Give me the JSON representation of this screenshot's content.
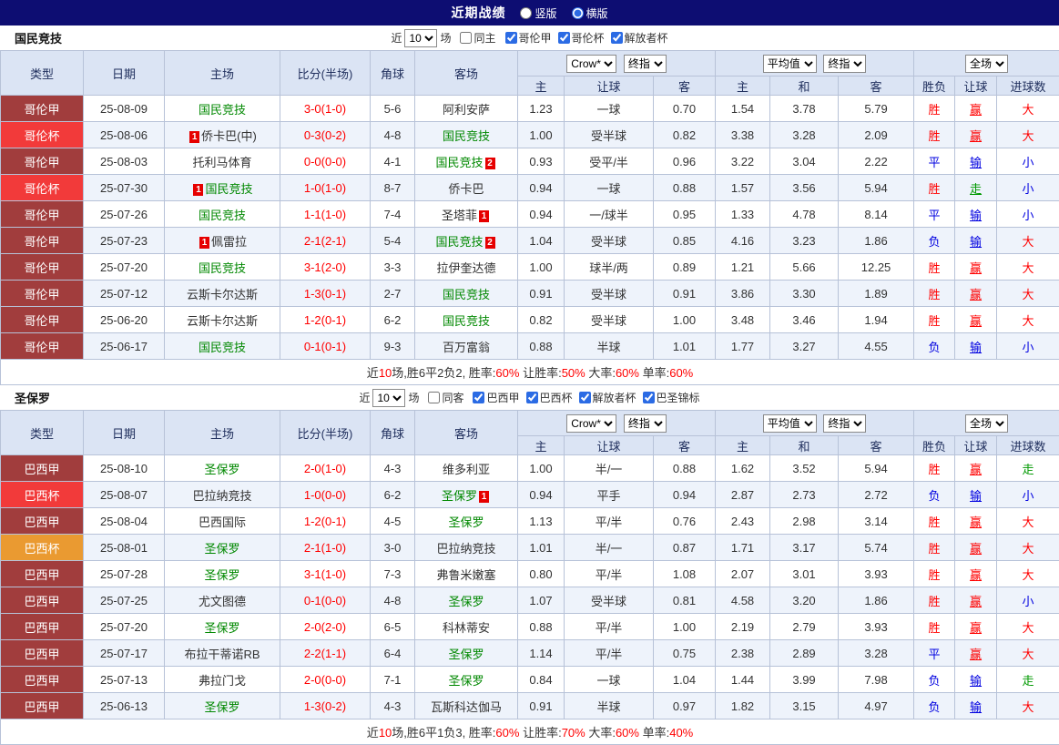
{
  "topbar": {
    "title": "近期战绩",
    "options": [
      {
        "label": "竖版",
        "selected": false
      },
      {
        "label": "横版",
        "selected": true
      }
    ]
  },
  "labels": {
    "recent": "近",
    "matches": "场"
  },
  "table_header": {
    "type": "类型",
    "date": "日期",
    "home": "主场",
    "score": "比分(半场)",
    "corners": "角球",
    "away": "客场",
    "sub": [
      "主",
      "让球",
      "客",
      "主",
      "和",
      "客",
      "胜负",
      "让球",
      "进球数"
    ],
    "selects": {
      "company": "Crow*",
      "final1": "终指",
      "avg": "平均值",
      "final2": "终指",
      "scope": "全场"
    }
  },
  "sections": [
    {
      "team": "国民竞技",
      "filters": {
        "count": "10",
        "same": {
          "label": "同主",
          "checked": false
        },
        "leagues": [
          {
            "label": "哥伦甲",
            "checked": true
          },
          {
            "label": "哥伦杯",
            "checked": true
          },
          {
            "label": "解放者杯",
            "checked": true
          }
        ]
      },
      "rows": [
        {
          "league": "哥伦甲",
          "lg": "a",
          "date": "25-08-09",
          "home": {
            "name": "国民竞技",
            "self": true
          },
          "score": "3-0(1-0)",
          "corners": "5-6",
          "away": {
            "name": "阿利安萨",
            "self": false
          },
          "handicap": [
            "1.23",
            "一球",
            "0.70"
          ],
          "europe": [
            "1.54",
            "3.78",
            "5.79"
          ],
          "results": [
            {
              "t": "胜",
              "c": "r"
            },
            {
              "t": "赢",
              "c": "r"
            },
            {
              "t": "大",
              "c": "r"
            }
          ]
        },
        {
          "league": "哥伦杯",
          "lg": "cup",
          "date": "25-08-06",
          "home": {
            "name": "侨卡巴(中)",
            "self": false,
            "badge": "1",
            "pos": "before"
          },
          "score": "0-3(0-2)",
          "corners": "4-8",
          "away": {
            "name": "国民竞技",
            "self": true
          },
          "handicap": [
            "1.00",
            "受半球",
            "0.82"
          ],
          "europe": [
            "3.38",
            "3.28",
            "2.09"
          ],
          "results": [
            {
              "t": "胜",
              "c": "r"
            },
            {
              "t": "赢",
              "c": "r"
            },
            {
              "t": "大",
              "c": "r"
            }
          ]
        },
        {
          "league": "哥伦甲",
          "lg": "a",
          "date": "25-08-03",
          "home": {
            "name": "托利马体育",
            "self": false
          },
          "score": "0-0(0-0)",
          "corners": "4-1",
          "away": {
            "name": "国民竞技",
            "self": true,
            "badge": "2",
            "pos": "after"
          },
          "handicap": [
            "0.93",
            "受平/半",
            "0.96"
          ],
          "europe": [
            "3.22",
            "3.04",
            "2.22"
          ],
          "results": [
            {
              "t": "平",
              "c": "b"
            },
            {
              "t": "输",
              "c": "b"
            },
            {
              "t": "小",
              "c": "b"
            }
          ]
        },
        {
          "league": "哥伦杯",
          "lg": "cup",
          "date": "25-07-30",
          "home": {
            "name": "国民竞技",
            "self": true,
            "badge": "1",
            "pos": "before"
          },
          "score": "1-0(1-0)",
          "corners": "8-7",
          "away": {
            "name": "侨卡巴",
            "self": false
          },
          "handicap": [
            "0.94",
            "一球",
            "0.88"
          ],
          "europe": [
            "1.57",
            "3.56",
            "5.94"
          ],
          "results": [
            {
              "t": "胜",
              "c": "r"
            },
            {
              "t": "走",
              "c": "g"
            },
            {
              "t": "小",
              "c": "b"
            }
          ]
        },
        {
          "league": "哥伦甲",
          "lg": "a",
          "date": "25-07-26",
          "home": {
            "name": "国民竞技",
            "self": true
          },
          "score": "1-1(1-0)",
          "corners": "7-4",
          "away": {
            "name": "圣塔菲",
            "self": false,
            "badge": "1",
            "pos": "after"
          },
          "handicap": [
            "0.94",
            "一/球半",
            "0.95"
          ],
          "europe": [
            "1.33",
            "4.78",
            "8.14"
          ],
          "results": [
            {
              "t": "平",
              "c": "b"
            },
            {
              "t": "输",
              "c": "b"
            },
            {
              "t": "小",
              "c": "b"
            }
          ]
        },
        {
          "league": "哥伦甲",
          "lg": "a",
          "date": "25-07-23",
          "home": {
            "name": "佩雷拉",
            "self": false,
            "badge": "1",
            "pos": "before"
          },
          "score": "2-1(2-1)",
          "corners": "5-4",
          "away": {
            "name": "国民竞技",
            "self": true,
            "badge": "2",
            "pos": "after"
          },
          "handicap": [
            "1.04",
            "受半球",
            "0.85"
          ],
          "europe": [
            "4.16",
            "3.23",
            "1.86"
          ],
          "results": [
            {
              "t": "负",
              "c": "b"
            },
            {
              "t": "输",
              "c": "b"
            },
            {
              "t": "大",
              "c": "r"
            }
          ]
        },
        {
          "league": "哥伦甲",
          "lg": "a",
          "date": "25-07-20",
          "home": {
            "name": "国民竞技",
            "self": true
          },
          "score": "3-1(2-0)",
          "corners": "3-3",
          "away": {
            "name": "拉伊奎达德",
            "self": false
          },
          "handicap": [
            "1.00",
            "球半/两",
            "0.89"
          ],
          "europe": [
            "1.21",
            "5.66",
            "12.25"
          ],
          "results": [
            {
              "t": "胜",
              "c": "r"
            },
            {
              "t": "赢",
              "c": "r"
            },
            {
              "t": "大",
              "c": "r"
            }
          ]
        },
        {
          "league": "哥伦甲",
          "lg": "a",
          "date": "25-07-12",
          "home": {
            "name": "云斯卡尔达斯",
            "self": false
          },
          "score": "1-3(0-1)",
          "corners": "2-7",
          "away": {
            "name": "国民竞技",
            "self": true
          },
          "handicap": [
            "0.91",
            "受半球",
            "0.91"
          ],
          "europe": [
            "3.86",
            "3.30",
            "1.89"
          ],
          "results": [
            {
              "t": "胜",
              "c": "r"
            },
            {
              "t": "赢",
              "c": "r"
            },
            {
              "t": "大",
              "c": "r"
            }
          ]
        },
        {
          "league": "哥伦甲",
          "lg": "a",
          "date": "25-06-20",
          "home": {
            "name": "云斯卡尔达斯",
            "self": false
          },
          "score": "1-2(0-1)",
          "corners": "6-2",
          "away": {
            "name": "国民竞技",
            "self": true
          },
          "handicap": [
            "0.82",
            "受半球",
            "1.00"
          ],
          "europe": [
            "3.48",
            "3.46",
            "1.94"
          ],
          "results": [
            {
              "t": "胜",
              "c": "r"
            },
            {
              "t": "赢",
              "c": "r"
            },
            {
              "t": "大",
              "c": "r"
            }
          ]
        },
        {
          "league": "哥伦甲",
          "lg": "a",
          "date": "25-06-17",
          "home": {
            "name": "国民竞技",
            "self": true
          },
          "score": "0-1(0-1)",
          "corners": "9-3",
          "away": {
            "name": "百万富翁",
            "self": false
          },
          "handicap": [
            "0.88",
            "半球",
            "1.01"
          ],
          "europe": [
            "1.77",
            "3.27",
            "4.55"
          ],
          "results": [
            {
              "t": "负",
              "c": "b"
            },
            {
              "t": "输",
              "c": "b"
            },
            {
              "t": "小",
              "c": "b"
            }
          ]
        }
      ],
      "summary": [
        {
          "t": "近"
        },
        {
          "t": "10",
          "red": true
        },
        {
          "t": "场,胜6平2负2, 胜率:"
        },
        {
          "t": "60%",
          "red": true
        },
        {
          "t": " 让胜率:"
        },
        {
          "t": "50%",
          "red": true
        },
        {
          "t": " 大率:"
        },
        {
          "t": "60%",
          "red": true
        },
        {
          "t": " 单率:"
        },
        {
          "t": "60%",
          "red": true
        }
      ]
    },
    {
      "team": "圣保罗",
      "filters": {
        "count": "10",
        "same": {
          "label": "同客",
          "checked": false
        },
        "leagues": [
          {
            "label": "巴西甲",
            "checked": true
          },
          {
            "label": "巴西杯",
            "checked": true
          },
          {
            "label": "解放者杯",
            "checked": true
          },
          {
            "label": "巴圣锦标",
            "checked": true
          }
        ]
      },
      "rows": [
        {
          "league": "巴西甲",
          "lg": "a",
          "date": "25-08-10",
          "home": {
            "name": "圣保罗",
            "self": true
          },
          "score": "2-0(1-0)",
          "corners": "4-3",
          "away": {
            "name": "维多利亚",
            "self": false
          },
          "handicap": [
            "1.00",
            "半/一",
            "0.88"
          ],
          "europe": [
            "1.62",
            "3.52",
            "5.94"
          ],
          "results": [
            {
              "t": "胜",
              "c": "r"
            },
            {
              "t": "赢",
              "c": "r"
            },
            {
              "t": "走",
              "c": "g"
            }
          ]
        },
        {
          "league": "巴西杯",
          "lg": "cup",
          "date": "25-08-07",
          "home": {
            "name": "巴拉纳竞技",
            "self": false
          },
          "score": "1-0(0-0)",
          "corners": "6-2",
          "away": {
            "name": "圣保罗",
            "self": true,
            "badge": "1",
            "pos": "after"
          },
          "handicap": [
            "0.94",
            "平手",
            "0.94"
          ],
          "europe": [
            "2.87",
            "2.73",
            "2.72"
          ],
          "results": [
            {
              "t": "负",
              "c": "b"
            },
            {
              "t": "输",
              "c": "b"
            },
            {
              "t": "小",
              "c": "b"
            }
          ]
        },
        {
          "league": "巴西甲",
          "lg": "a",
          "date": "25-08-04",
          "home": {
            "name": "巴西国际",
            "self": false
          },
          "score": "1-2(0-1)",
          "corners": "4-5",
          "away": {
            "name": "圣保罗",
            "self": true
          },
          "handicap": [
            "1.13",
            "平/半",
            "0.76"
          ],
          "europe": [
            "2.43",
            "2.98",
            "3.14"
          ],
          "results": [
            {
              "t": "胜",
              "c": "r"
            },
            {
              "t": "赢",
              "c": "r"
            },
            {
              "t": "大",
              "c": "r"
            }
          ]
        },
        {
          "league": "巴西杯",
          "lg": "or",
          "date": "25-08-01",
          "home": {
            "name": "圣保罗",
            "self": true
          },
          "score": "2-1(1-0)",
          "corners": "3-0",
          "away": {
            "name": "巴拉纳竞技",
            "self": false
          },
          "handicap": [
            "1.01",
            "半/一",
            "0.87"
          ],
          "europe": [
            "1.71",
            "3.17",
            "5.74"
          ],
          "results": [
            {
              "t": "胜",
              "c": "r"
            },
            {
              "t": "赢",
              "c": "r"
            },
            {
              "t": "大",
              "c": "r"
            }
          ]
        },
        {
          "league": "巴西甲",
          "lg": "a",
          "date": "25-07-28",
          "home": {
            "name": "圣保罗",
            "self": true
          },
          "score": "3-1(1-0)",
          "corners": "7-3",
          "away": {
            "name": "弗鲁米嫩塞",
            "self": false
          },
          "handicap": [
            "0.80",
            "平/半",
            "1.08"
          ],
          "europe": [
            "2.07",
            "3.01",
            "3.93"
          ],
          "results": [
            {
              "t": "胜",
              "c": "r"
            },
            {
              "t": "赢",
              "c": "r"
            },
            {
              "t": "大",
              "c": "r"
            }
          ]
        },
        {
          "league": "巴西甲",
          "lg": "a",
          "date": "25-07-25",
          "home": {
            "name": "尤文图德",
            "self": false
          },
          "score": "0-1(0-0)",
          "corners": "4-8",
          "away": {
            "name": "圣保罗",
            "self": true
          },
          "handicap": [
            "1.07",
            "受半球",
            "0.81"
          ],
          "europe": [
            "4.58",
            "3.20",
            "1.86"
          ],
          "results": [
            {
              "t": "胜",
              "c": "r"
            },
            {
              "t": "赢",
              "c": "r"
            },
            {
              "t": "小",
              "c": "b"
            }
          ]
        },
        {
          "league": "巴西甲",
          "lg": "a",
          "date": "25-07-20",
          "home": {
            "name": "圣保罗",
            "self": true
          },
          "score": "2-0(2-0)",
          "corners": "6-5",
          "away": {
            "name": "科林蒂安",
            "self": false
          },
          "handicap": [
            "0.88",
            "平/半",
            "1.00"
          ],
          "europe": [
            "2.19",
            "2.79",
            "3.93"
          ],
          "results": [
            {
              "t": "胜",
              "c": "r"
            },
            {
              "t": "赢",
              "c": "r"
            },
            {
              "t": "大",
              "c": "r"
            }
          ]
        },
        {
          "league": "巴西甲",
          "lg": "a",
          "date": "25-07-17",
          "home": {
            "name": "布拉干蒂诺RB",
            "self": false
          },
          "score": "2-2(1-1)",
          "corners": "6-4",
          "away": {
            "name": "圣保罗",
            "self": true
          },
          "handicap": [
            "1.14",
            "平/半",
            "0.75"
          ],
          "europe": [
            "2.38",
            "2.89",
            "3.28"
          ],
          "results": [
            {
              "t": "平",
              "c": "b"
            },
            {
              "t": "赢",
              "c": "r"
            },
            {
              "t": "大",
              "c": "r"
            }
          ]
        },
        {
          "league": "巴西甲",
          "lg": "a",
          "date": "25-07-13",
          "home": {
            "name": "弗拉门戈",
            "self": false
          },
          "score": "2-0(0-0)",
          "corners": "7-1",
          "away": {
            "name": "圣保罗",
            "self": true
          },
          "handicap": [
            "0.84",
            "一球",
            "1.04"
          ],
          "europe": [
            "1.44",
            "3.99",
            "7.98"
          ],
          "results": [
            {
              "t": "负",
              "c": "b"
            },
            {
              "t": "输",
              "c": "b"
            },
            {
              "t": "走",
              "c": "g"
            }
          ]
        },
        {
          "league": "巴西甲",
          "lg": "a",
          "date": "25-06-13",
          "home": {
            "name": "圣保罗",
            "self": true
          },
          "score": "1-3(0-2)",
          "corners": "4-3",
          "away": {
            "name": "瓦斯科达伽马",
            "self": false
          },
          "handicap": [
            "0.91",
            "半球",
            "0.97"
          ],
          "europe": [
            "1.82",
            "3.15",
            "4.97"
          ],
          "results": [
            {
              "t": "负",
              "c": "b"
            },
            {
              "t": "输",
              "c": "b"
            },
            {
              "t": "大",
              "c": "r"
            }
          ]
        }
      ],
      "summary": [
        {
          "t": "近"
        },
        {
          "t": "10",
          "red": true
        },
        {
          "t": "场,胜6平1负3, 胜率:"
        },
        {
          "t": "60%",
          "red": true
        },
        {
          "t": " 让胜率:"
        },
        {
          "t": "70%",
          "red": true
        },
        {
          "t": " 大率:"
        },
        {
          "t": "60%",
          "red": true
        },
        {
          "t": " 单率:"
        },
        {
          "t": "40%",
          "red": true
        }
      ]
    }
  ]
}
